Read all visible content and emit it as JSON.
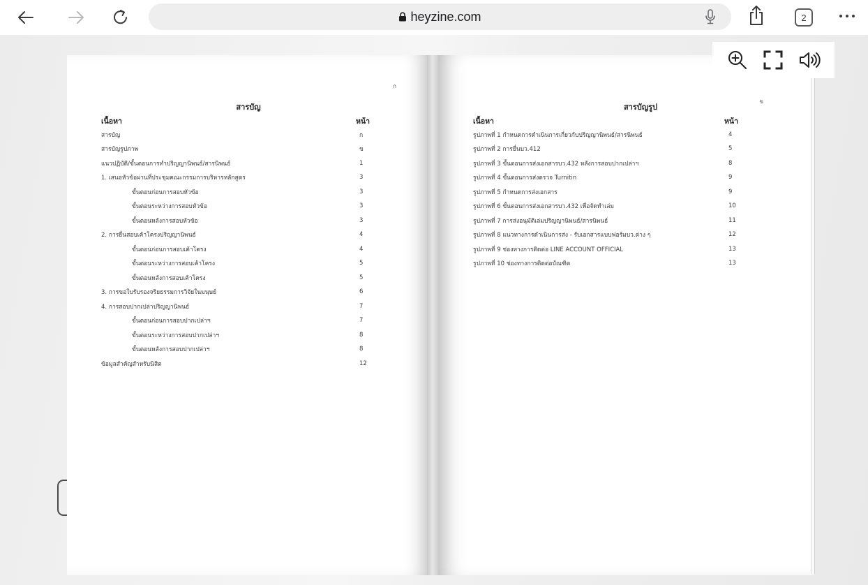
{
  "browser": {
    "url": "heyzine.com",
    "tab_count": "2",
    "icons": {
      "back": "back-arrow-icon",
      "forward": "forward-arrow-icon",
      "reload": "reload-icon",
      "lock": "lock-icon",
      "mic": "microphone-icon",
      "share": "share-icon",
      "tabs": "tabs-icon",
      "more": "more-icon"
    }
  },
  "viewer": {
    "controls": [
      "zoom-in-icon",
      "fullscreen-icon",
      "sound-icon"
    ]
  },
  "left_page": {
    "page_marker": "ก",
    "title": "สารบัญ",
    "col_content": "เนื้อหา",
    "col_page": "หน้า",
    "rows": [
      {
        "label": "สารบัญ",
        "page": "ก",
        "indent": false
      },
      {
        "label": "สารบัญรูปภาพ",
        "page": "ข",
        "indent": false
      },
      {
        "label": "แนวปฏิบัติ/ขั้นตอนการทำปริญญานิพนธ์/สารนิพนธ์",
        "page": "1",
        "indent": false
      },
      {
        "label": "1. เสนอหัวข้อผ่านที่ประชุมคณะกรรมการบริหารหลักสูตร",
        "page": "3",
        "indent": false
      },
      {
        "label": "ขั้นตอนก่อนการสอบหัวข้อ",
        "page": "3",
        "indent": true
      },
      {
        "label": "ขั้นตอนระหว่างการสอบหัวข้อ",
        "page": "3",
        "indent": true
      },
      {
        "label": "ขั้นตอนหลังการสอบหัวข้อ",
        "page": "3",
        "indent": true
      },
      {
        "label": "2. การยื่นสอบเค้าโครงปริญญานิพนธ์",
        "page": "4",
        "indent": false
      },
      {
        "label": "ขั้นตอนก่อนการสอบเค้าโครง",
        "page": "4",
        "indent": true
      },
      {
        "label": "ขั้นตอนระหว่างการสอบเค้าโครง",
        "page": "5",
        "indent": true
      },
      {
        "label": "ขั้นตอนหลังการสอบเค้าโครง",
        "page": "5",
        "indent": true
      },
      {
        "label": "3. การขอใบรับรองจริยธรรมการวิจัยในมนุษย์",
        "page": "6",
        "indent": false
      },
      {
        "label": "4. การสอบปากเปล่าปริญญานิพนธ์",
        "page": "7",
        "indent": false
      },
      {
        "label": "ขั้นตอนก่อนการสอบปากเปล่าฯ",
        "page": "7",
        "indent": true
      },
      {
        "label": "ขั้นตอนระหว่างการสอบปากเปล่าฯ",
        "page": "8",
        "indent": true
      },
      {
        "label": "ขั้นตอนหลังการสอบปากเปล่าฯ",
        "page": "8",
        "indent": true
      },
      {
        "label": "ข้อมูลสำคัญสำหรับนิสิต",
        "page": "12",
        "indent": false
      }
    ]
  },
  "right_page": {
    "page_marker": "ข",
    "title": "สารบัญรูป",
    "col_content": "เนื้อหา",
    "col_page": "หน้า",
    "rows": [
      {
        "label": "รูปภาพที่ 1 กำหนดการดำเนินการเกี่ยวกับปริญญานิพนธ์/สารนิพนธ์",
        "page": "4"
      },
      {
        "label": "รูปภาพที่ 2 การยื่นบว.412",
        "page": "5"
      },
      {
        "label": "รูปภาพที่ 3 ขั้นตอนการส่งเอกสารบว.432 หลังการสอบปากเปล่าฯ",
        "page": "8"
      },
      {
        "label": "รูปภาพที่ 4 ขั้นตอนการส่งตรวจ Turnitin",
        "page": "9"
      },
      {
        "label": "รูปภาพที่ 5 กำหนดการส่งเอกสาร",
        "page": "9"
      },
      {
        "label": "รูปภาพที่ 6 ขั้นตอนการส่งเอกสารบว.432 เพื่อจัดทำเล่ม",
        "page": "10"
      },
      {
        "label": "รูปภาพที่ 7 การส่งอนุมัติเล่มปริญญานิพนธ์/สารนิพนธ์",
        "page": "11"
      },
      {
        "label": "รูปภาพที่ 8 แนวทางการดำเนินการส่ง - รับเอกสารแบบฟอร์มบว.ต่าง ๆ",
        "page": "12"
      },
      {
        "label": "รูปภาพที่ 9 ช่องทางการติดต่อ LINE ACCOUNT OFFICIAL",
        "page": "13"
      },
      {
        "label": "รูปภาพที่ 10 ช่องทางการติดต่อบัณฑิต",
        "page": "13"
      }
    ]
  }
}
